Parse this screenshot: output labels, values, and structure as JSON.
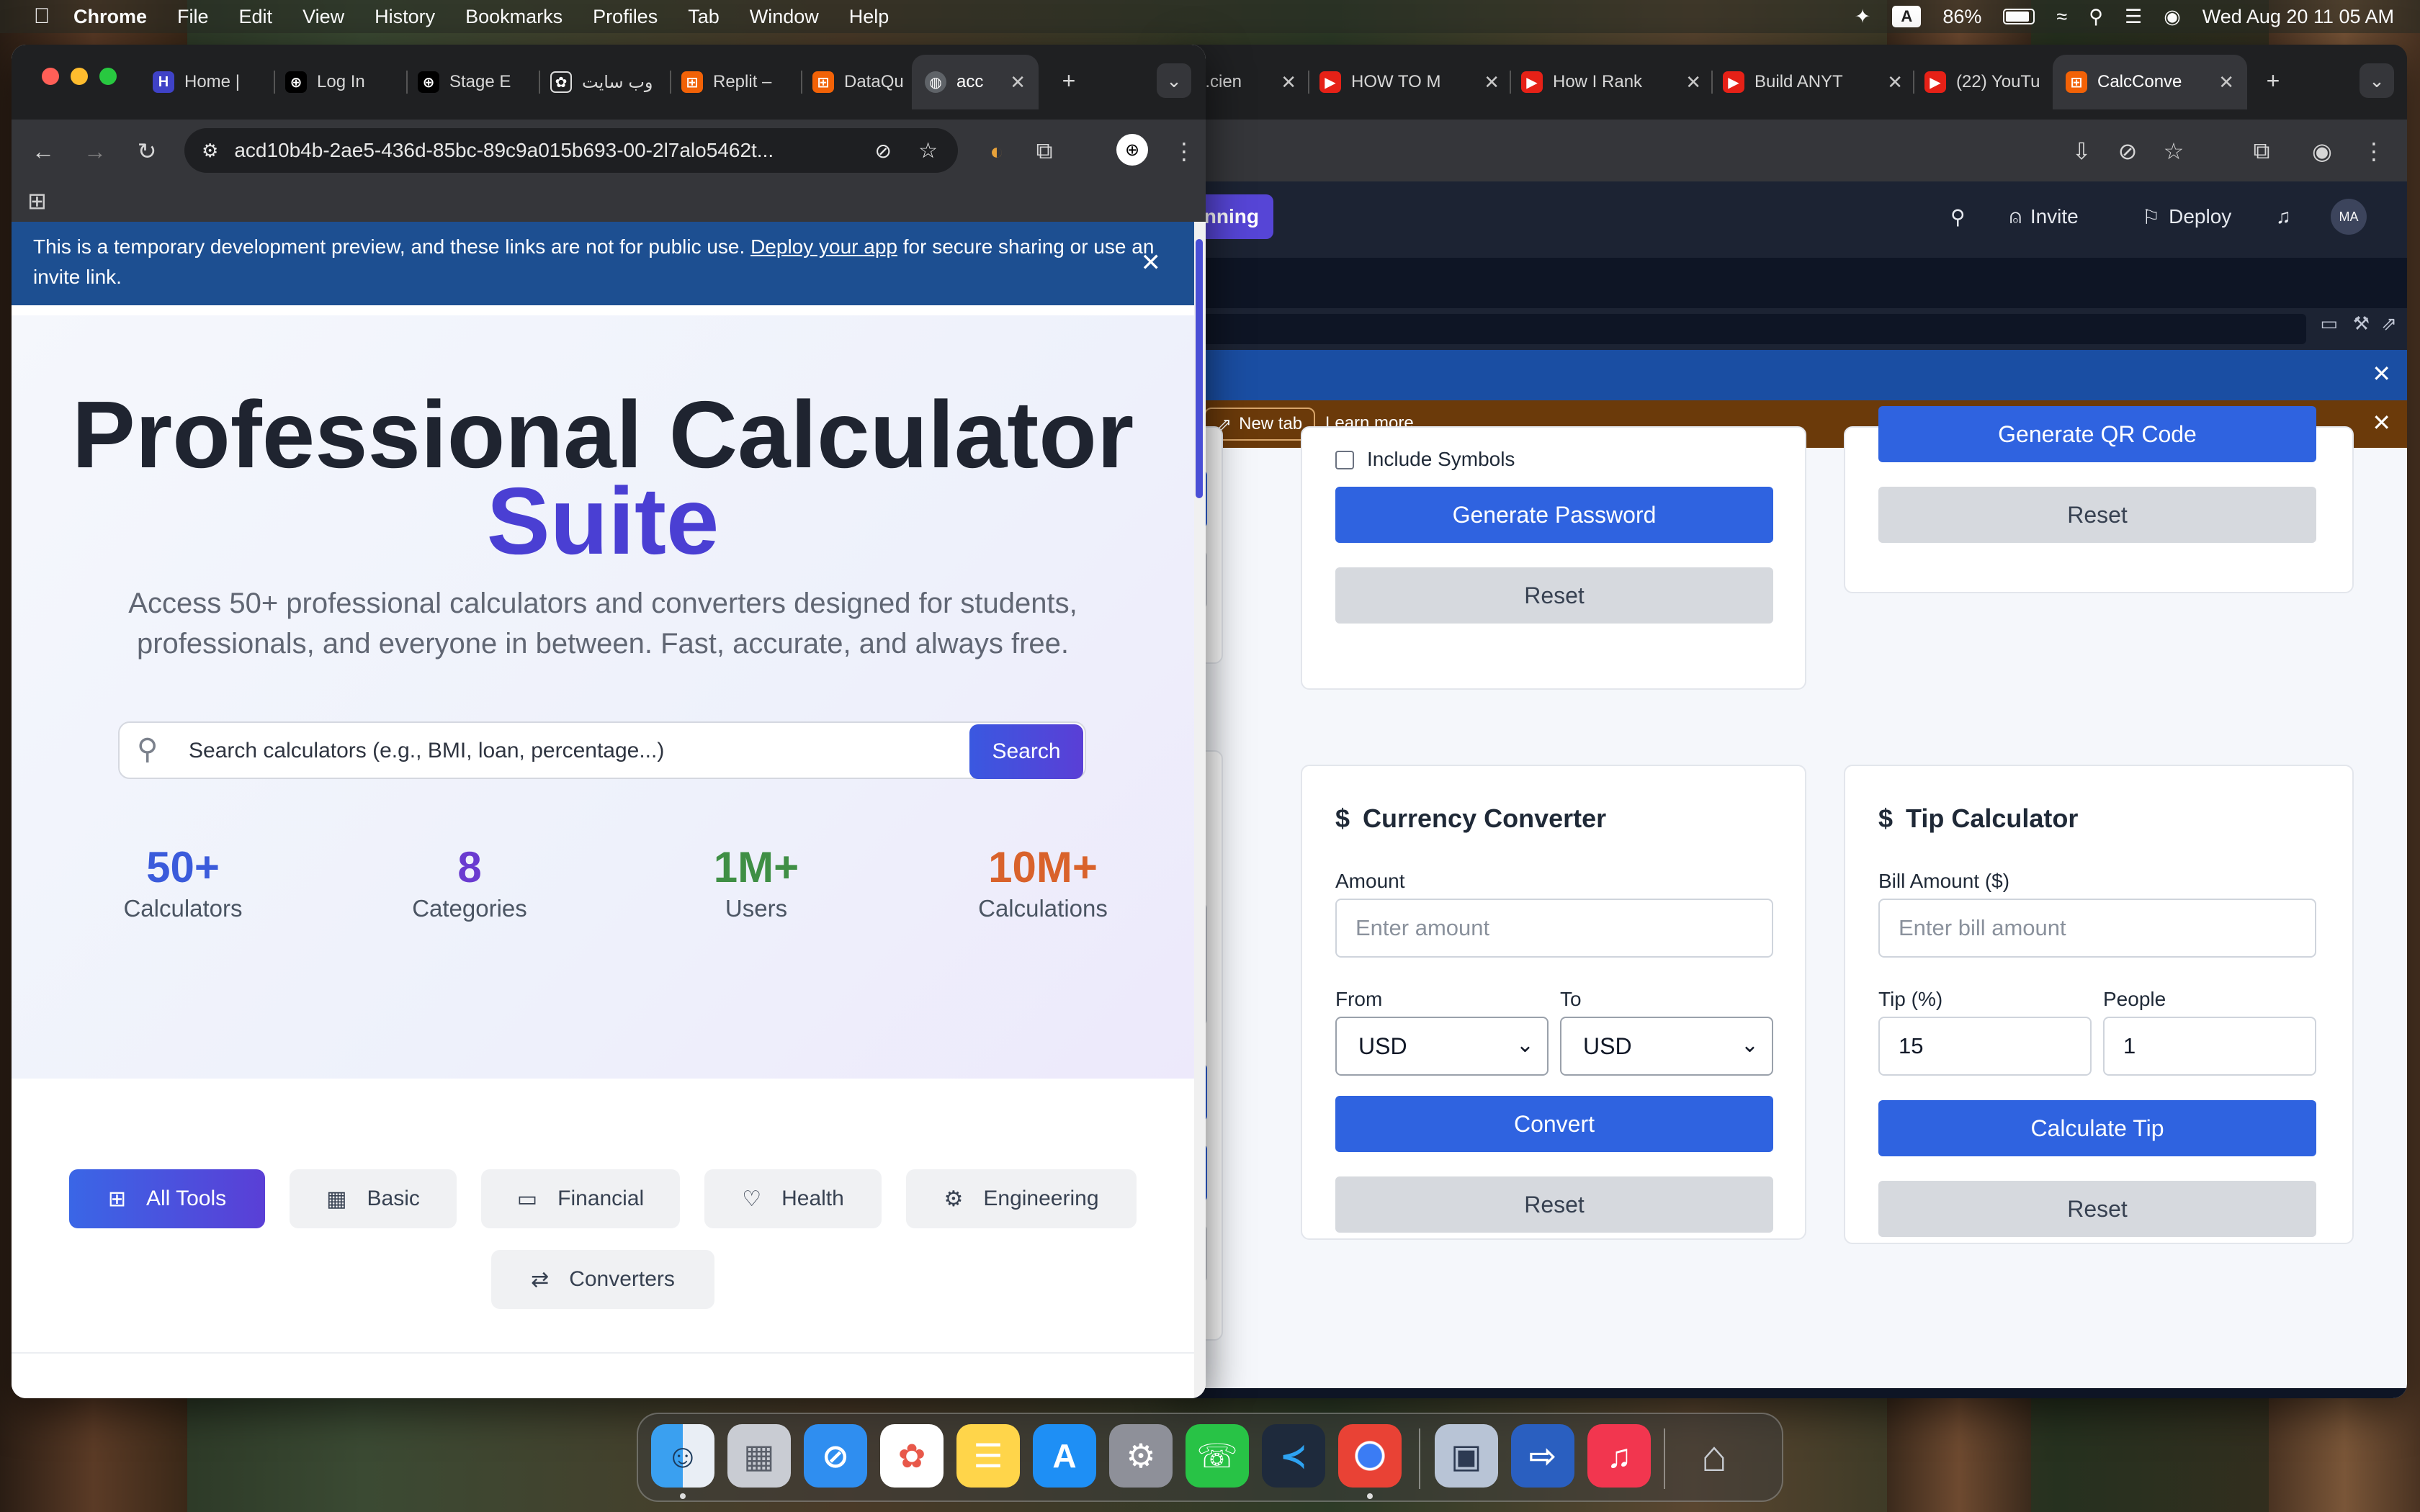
{
  "menubar": {
    "app": "Chrome",
    "items": [
      "File",
      "Edit",
      "View",
      "History",
      "Bookmarks",
      "Profiles",
      "Tab",
      "Window",
      "Help"
    ],
    "input_indicator": "A",
    "battery": "86%",
    "datetime": "Wed Aug 20  11 05 AM"
  },
  "back_window": {
    "tabs": [
      {
        "title": "...cien",
        "icon": "generic-tab-icon"
      },
      {
        "title": "HOW TO M",
        "icon": "youtube-icon"
      },
      {
        "title": "How I Rank",
        "icon": "youtube-icon"
      },
      {
        "title": "Build ANYT",
        "icon": "youtube-icon"
      },
      {
        "title": "(22) YouTu",
        "icon": "youtube-icon"
      },
      {
        "title": "CalcConve",
        "icon": "replit-icon"
      }
    ],
    "replit": {
      "run_label": "unning",
      "invite_label": "Invite",
      "deploy_label": "Deploy",
      "avatar": "MA",
      "newtab_label": "New tab",
      "learn_more": "Learn more"
    },
    "password_card": {
      "checkbox_label": "Include Symbols",
      "generate_label": "Generate Password",
      "reset_label": "Reset"
    },
    "qr_card": {
      "generate_label": "Generate QR Code",
      "reset_label": "Reset"
    },
    "currency_card": {
      "title": "Currency Converter",
      "amount_label": "Amount",
      "amount_placeholder": "Enter amount",
      "from_label": "From",
      "to_label": "To",
      "from_value": "USD",
      "to_value": "USD",
      "convert_label": "Convert",
      "reset_label": "Reset"
    },
    "tip_card": {
      "title": "Tip Calculator",
      "bill_label": "Bill Amount ($)",
      "bill_placeholder": "Enter bill amount",
      "tip_label": "Tip (%)",
      "people_label": "People",
      "tip_value": "15",
      "people_value": "1",
      "calc_label": "Calculate Tip",
      "reset_label": "Reset"
    }
  },
  "front_window": {
    "tabs": [
      {
        "title": "Home |",
        "icon": "hashnode-icon"
      },
      {
        "title": "Log In",
        "icon": "link-icon"
      },
      {
        "title": "Stage E",
        "icon": "link-icon"
      },
      {
        "title": "وب سایت",
        "icon": "openai-icon"
      },
      {
        "title": "Replit –",
        "icon": "replit-icon"
      },
      {
        "title": "DataQu",
        "icon": "replit-icon"
      },
      {
        "title": "acc",
        "icon": "globe-icon"
      }
    ],
    "url": "acd10b4b-2ae5-436d-85bc-89c9a015b693-00-2l7alo5462t...",
    "notice": {
      "text_before": "This is a temporary development preview, and these links are not for public use.",
      "link": "Deploy your app",
      "text_after": "for secure sharing or use an invite link."
    },
    "hero": {
      "title_line1": "Professional Calculator",
      "title_line2": "Suite",
      "subtitle": "Access 50+ professional calculators and converters designed for students, professionals, and everyone in between. Fast, accurate, and always free.",
      "search_placeholder": "Search calculators (e.g., BMI, loan, percentage...)",
      "search_button": "Search"
    },
    "stats": [
      {
        "value": "50+",
        "label": "Calculators",
        "color": "#3b5bdb"
      },
      {
        "value": "8",
        "label": "Categories",
        "color": "#6a3bd0"
      },
      {
        "value": "1M+",
        "label": "Users",
        "color": "#3f8f45"
      },
      {
        "value": "10M+",
        "label": "Calculations",
        "color": "#d9622b"
      }
    ],
    "categories": [
      {
        "label": "All Tools",
        "icon": "grid-icon"
      },
      {
        "label": "Basic",
        "icon": "calculator-icon"
      },
      {
        "label": "Financial",
        "icon": "money-icon"
      },
      {
        "label": "Health",
        "icon": "heart-icon"
      },
      {
        "label": "Engineering",
        "icon": "gear-icon"
      },
      {
        "label": "Converters",
        "icon": "swap-icon"
      }
    ]
  }
}
